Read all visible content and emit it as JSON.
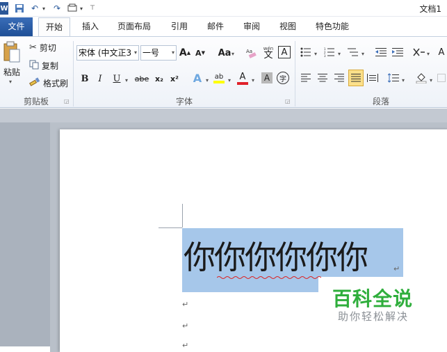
{
  "window": {
    "title": "文档1"
  },
  "tabs": [
    "文件",
    "开始",
    "插入",
    "页面布局",
    "引用",
    "邮件",
    "审阅",
    "视图",
    "特色功能"
  ],
  "clipboard": {
    "paste_label": "粘贴",
    "cut_label": "剪切",
    "copy_label": "复制",
    "format_painter_label": "格式刷",
    "group_label": "剪贴板"
  },
  "font": {
    "font_name": "宋体 (中文正3",
    "font_size": "一号",
    "group_label": "字体",
    "bold": "B",
    "italic": "I",
    "underline": "U",
    "strike": "abe",
    "subscript": "x₂",
    "superscript": "x²",
    "change_case": "Aa",
    "grow": "A",
    "shrink": "A",
    "phonetic": "wén",
    "phonetic_char": "文",
    "border_char": "A",
    "text_effect": "A",
    "highlight": "ab",
    "font_color": "A",
    "char_shade": "A",
    "enclose": "字"
  },
  "paragraph": {
    "group_label": "段落"
  },
  "document": {
    "headline": "你你你你你你"
  },
  "watermark": {
    "title": "百科全说",
    "subtitle": "助你轻松解决"
  },
  "colors": {
    "file_tab": "#2b5797",
    "selection": "#a6c7ea",
    "watermark_green": "#2fae3c"
  }
}
